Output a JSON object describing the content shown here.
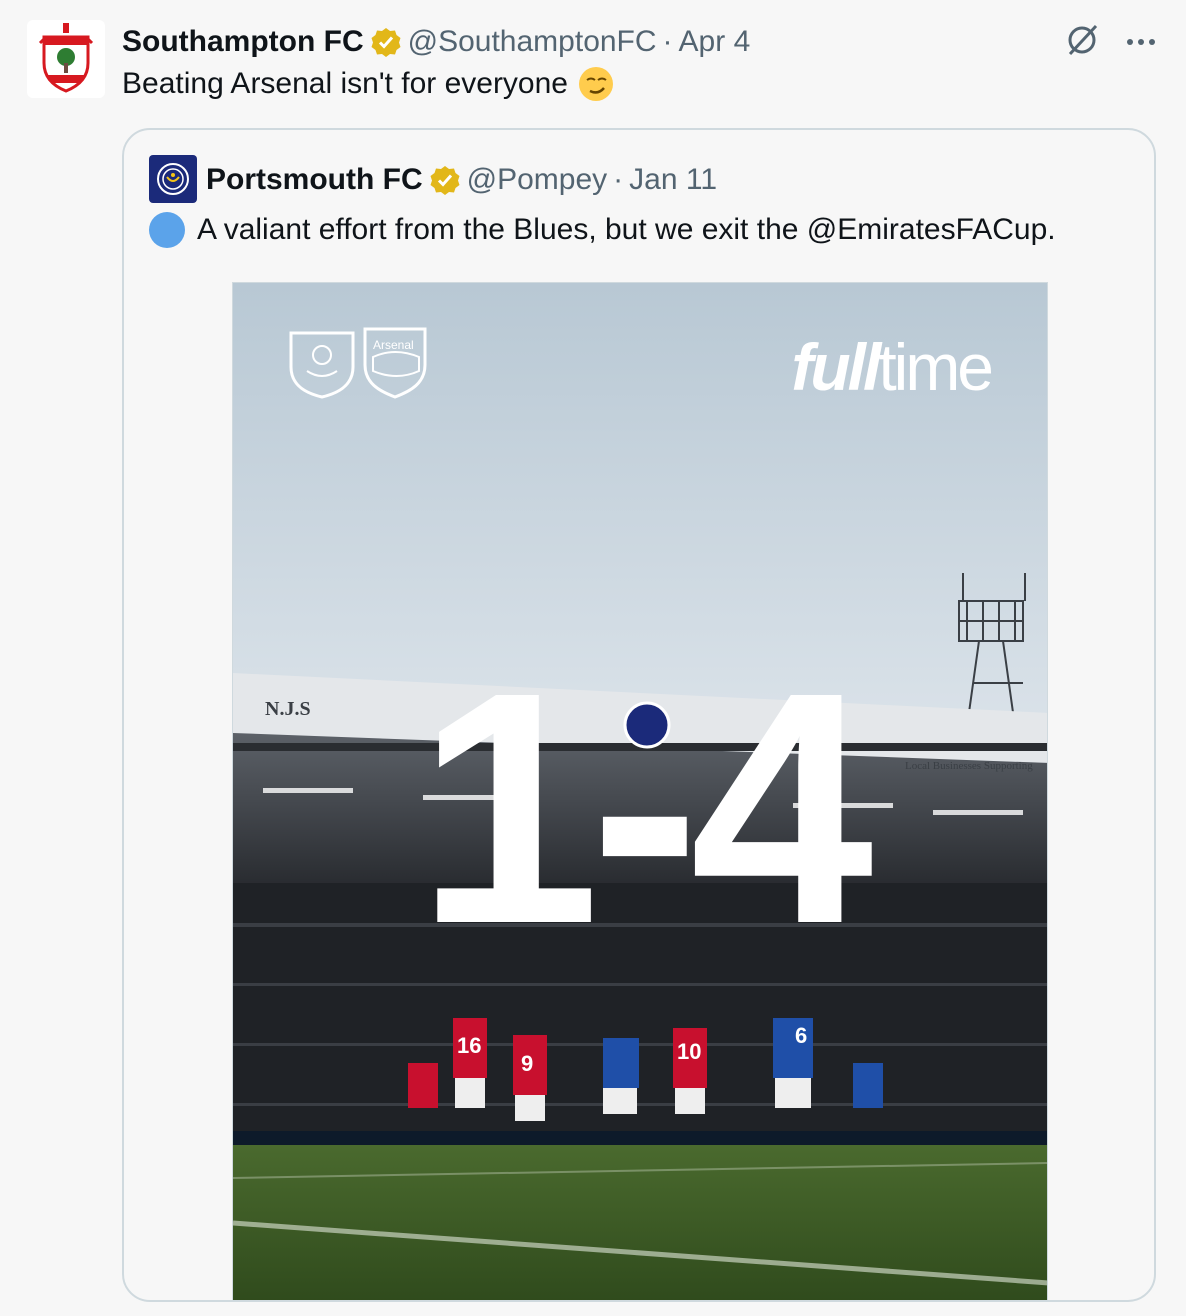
{
  "tweet": {
    "author_name": "Southampton FC",
    "handle": "@SouthamptonFC",
    "separator": "·",
    "date": "Apr 4",
    "text": "Beating Arsenal isn't for everyone",
    "emoji": "smirking-face"
  },
  "quoted": {
    "author_name": "Portsmouth FC",
    "handle": "@Pompey",
    "separator": "·",
    "date": "Jan 11",
    "text": "A valiant effort from the Blues, but we exit the @EmiratesFACup."
  },
  "media": {
    "headline_bold": "full",
    "headline_light": "time",
    "score": "1-4",
    "crest_label": "Arsenal",
    "sign_left": "N.J.S",
    "sign_right": "Local Businesses Supporting",
    "jersey_numbers": [
      "16",
      "9",
      "10",
      "6"
    ]
  },
  "colors": {
    "accent_blue": "#1d9bf0",
    "verified_gold": "#e2b719",
    "muted_text": "#536471"
  }
}
